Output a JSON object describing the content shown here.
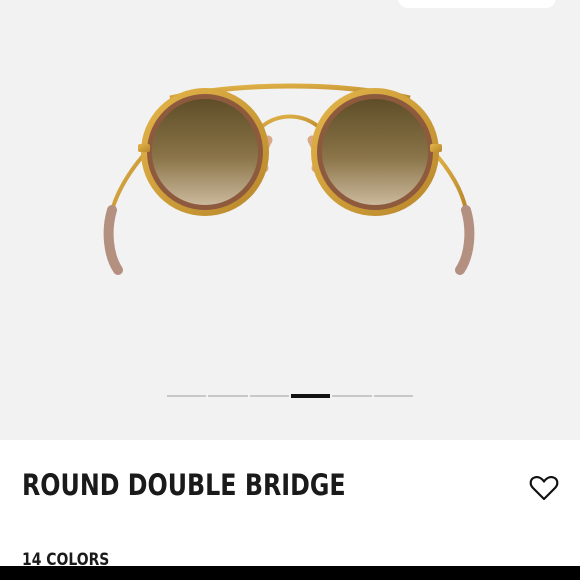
{
  "product": {
    "title": "ROUND DOUBLE BRIDGE",
    "colors_label": "14 COLORS"
  },
  "carousel": {
    "total_slides": 6,
    "active_slide": 4
  },
  "icons": {
    "favorite": "heart-outline-icon"
  },
  "colors": {
    "hero_background": "#f2f2f2",
    "active_indicator": "#111111",
    "inactive_indicator": "#c8c8c8",
    "frame_gold": "#c9962e",
    "lens_brown": "#6b5a2e"
  }
}
